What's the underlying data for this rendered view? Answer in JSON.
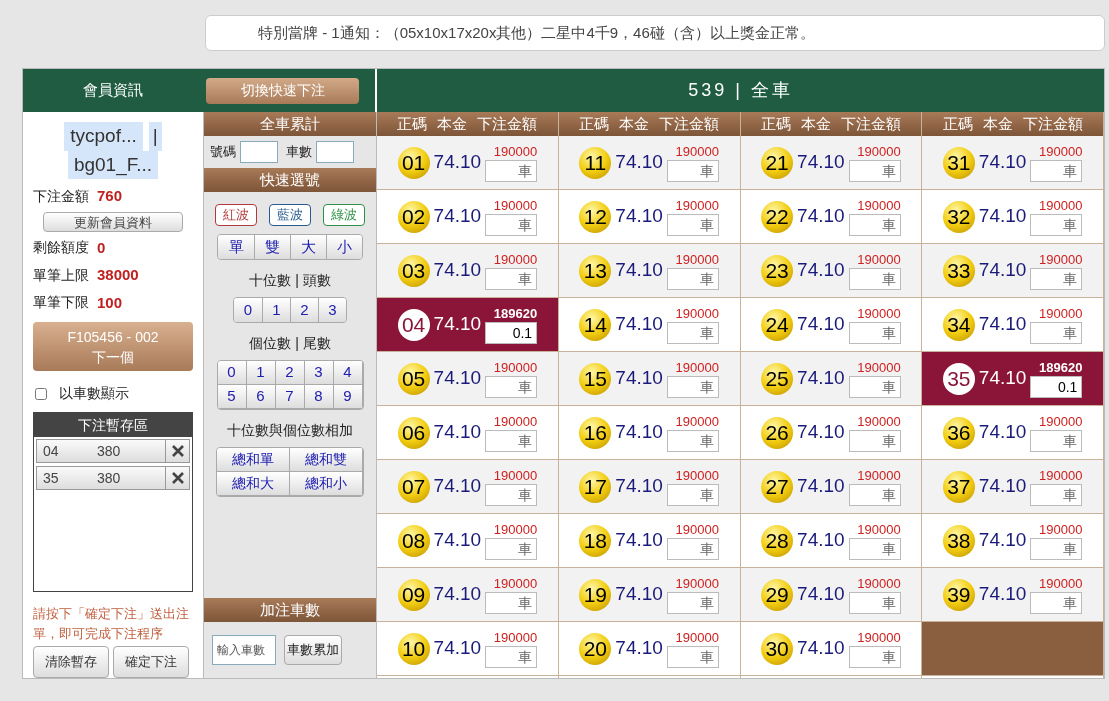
{
  "notice": "特別當牌 - 1通知：（05x10x17x20x其他）二星中4千9，46碰（含）以上獎金正常。",
  "header": {
    "member_tab": "會員資訊",
    "quick_bet_button": "切換快速下注",
    "game_title": "539 | 全車"
  },
  "member": {
    "usernames": [
      "tycpof...",
      "bg01_F..."
    ],
    "separator": "|",
    "bet_amount": {
      "label": "下注金額",
      "value": "760"
    },
    "refresh_button": "更新會員資料",
    "limits": [
      {
        "label": "剩餘額度",
        "value": "0"
      },
      {
        "label": "單筆上限",
        "value": "38000"
      },
      {
        "label": "單筆下限",
        "value": "100"
      }
    ],
    "next_button": {
      "line1": "F105456 - 002",
      "line2": "下一個"
    },
    "show_by_count": {
      "label": "以車數顯示",
      "checked": false
    },
    "staging": {
      "title": "下注暫存區",
      "items": [
        {
          "number": "04",
          "amount": "380"
        },
        {
          "number": "35",
          "amount": "380"
        }
      ]
    },
    "hint": "請按下「確定下注」送出注單，即可完成下注程序",
    "buttons": [
      "清除暫存",
      "確定下注"
    ]
  },
  "total": {
    "title": "全車累計",
    "number_label": "號碼",
    "count_label": "車數"
  },
  "quick_pick": {
    "title": "快速選號",
    "waves": [
      {
        "label": "紅波",
        "color": "#b03a3a"
      },
      {
        "label": "藍波",
        "color": "#2a5a90"
      },
      {
        "label": "綠波",
        "color": "#2f8f47"
      }
    ],
    "parity": [
      "單",
      "雙",
      "大",
      "小"
    ],
    "tens_label": "十位數 | 頭數",
    "tens": [
      "0",
      "1",
      "2",
      "3"
    ],
    "units_label": "個位數 | 尾數",
    "units": [
      "0",
      "1",
      "2",
      "3",
      "4",
      "5",
      "6",
      "7",
      "8",
      "9"
    ],
    "sum_label": "十位數與個位數相加",
    "sums": [
      "總和單",
      "總和雙",
      "總和大",
      "總和小"
    ]
  },
  "add_count": {
    "title": "加注車數",
    "placeholder": "輸入車數",
    "button": "車數累加"
  },
  "grid_headers": [
    [
      "正碼",
      "本金",
      "下注金額"
    ],
    [
      "正碼",
      "本金",
      "下注金額"
    ],
    [
      "正碼",
      "本金",
      "下注金額"
    ],
    [
      "正碼",
      "本金",
      "下注金額"
    ]
  ],
  "columns": [
    [
      {
        "kind": "number",
        "number": "01",
        "odds": "74.10",
        "limit": "190000",
        "placeholder": "車",
        "selected": false
      },
      {
        "kind": "number",
        "number": "02",
        "odds": "74.10",
        "limit": "190000",
        "placeholder": "車",
        "selected": false
      },
      {
        "kind": "number",
        "number": "03",
        "odds": "74.10",
        "limit": "190000",
        "placeholder": "車",
        "selected": false
      },
      {
        "kind": "number",
        "number": "04",
        "odds": "74.10",
        "limit": "189620",
        "value": "0.1",
        "selected": true
      },
      {
        "kind": "number",
        "number": "05",
        "odds": "74.10",
        "limit": "190000",
        "placeholder": "車",
        "selected": false
      },
      {
        "kind": "number",
        "number": "06",
        "odds": "74.10",
        "limit": "190000",
        "placeholder": "車",
        "selected": false
      },
      {
        "kind": "number",
        "number": "07",
        "odds": "74.10",
        "limit": "190000",
        "placeholder": "車",
        "selected": false
      },
      {
        "kind": "number",
        "number": "08",
        "odds": "74.10",
        "limit": "190000",
        "placeholder": "車",
        "selected": false
      },
      {
        "kind": "number",
        "number": "09",
        "odds": "74.10",
        "limit": "190000",
        "placeholder": "車",
        "selected": false
      },
      {
        "kind": "number",
        "number": "10",
        "odds": "74.10",
        "limit": "190000",
        "placeholder": "車",
        "selected": false
      }
    ],
    [
      {
        "kind": "number",
        "number": "11",
        "odds": "74.10",
        "limit": "190000",
        "placeholder": "車",
        "selected": false
      },
      {
        "kind": "number",
        "number": "12",
        "odds": "74.10",
        "limit": "190000",
        "placeholder": "車",
        "selected": false
      },
      {
        "kind": "number",
        "number": "13",
        "odds": "74.10",
        "limit": "190000",
        "placeholder": "車",
        "selected": false
      },
      {
        "kind": "number",
        "number": "14",
        "odds": "74.10",
        "limit": "190000",
        "placeholder": "車",
        "selected": false
      },
      {
        "kind": "number",
        "number": "15",
        "odds": "74.10",
        "limit": "190000",
        "placeholder": "車",
        "selected": false
      },
      {
        "kind": "number",
        "number": "16",
        "odds": "74.10",
        "limit": "190000",
        "placeholder": "車",
        "selected": false
      },
      {
        "kind": "number",
        "number": "17",
        "odds": "74.10",
        "limit": "190000",
        "placeholder": "車",
        "selected": false
      },
      {
        "kind": "number",
        "number": "18",
        "odds": "74.10",
        "limit": "190000",
        "placeholder": "車",
        "selected": false
      },
      {
        "kind": "number",
        "number": "19",
        "odds": "74.10",
        "limit": "190000",
        "placeholder": "車",
        "selected": false
      },
      {
        "kind": "number",
        "number": "20",
        "odds": "74.10",
        "limit": "190000",
        "placeholder": "車",
        "selected": false
      }
    ],
    [
      {
        "kind": "number",
        "number": "21",
        "odds": "74.10",
        "limit": "190000",
        "placeholder": "車",
        "selected": false
      },
      {
        "kind": "number",
        "number": "22",
        "odds": "74.10",
        "limit": "190000",
        "placeholder": "車",
        "selected": false
      },
      {
        "kind": "number",
        "number": "23",
        "odds": "74.10",
        "limit": "190000",
        "placeholder": "車",
        "selected": false
      },
      {
        "kind": "number",
        "number": "24",
        "odds": "74.10",
        "limit": "190000",
        "placeholder": "車",
        "selected": false
      },
      {
        "kind": "number",
        "number": "25",
        "odds": "74.10",
        "limit": "190000",
        "placeholder": "車",
        "selected": false
      },
      {
        "kind": "number",
        "number": "26",
        "odds": "74.10",
        "limit": "190000",
        "placeholder": "車",
        "selected": false
      },
      {
        "kind": "number",
        "number": "27",
        "odds": "74.10",
        "limit": "190000",
        "placeholder": "車",
        "selected": false
      },
      {
        "kind": "number",
        "number": "28",
        "odds": "74.10",
        "limit": "190000",
        "placeholder": "車",
        "selected": false
      },
      {
        "kind": "number",
        "number": "29",
        "odds": "74.10",
        "limit": "190000",
        "placeholder": "車",
        "selected": false
      },
      {
        "kind": "number",
        "number": "30",
        "odds": "74.10",
        "limit": "190000",
        "placeholder": "車",
        "selected": false
      }
    ],
    [
      {
        "kind": "number",
        "number": "31",
        "odds": "74.10",
        "limit": "190000",
        "placeholder": "車",
        "selected": false
      },
      {
        "kind": "number",
        "number": "32",
        "odds": "74.10",
        "limit": "190000",
        "placeholder": "車",
        "selected": false
      },
      {
        "kind": "number",
        "number": "33",
        "odds": "74.10",
        "limit": "190000",
        "placeholder": "車",
        "selected": false
      },
      {
        "kind": "number",
        "number": "34",
        "odds": "74.10",
        "limit": "190000",
        "placeholder": "車",
        "selected": false
      },
      {
        "kind": "number",
        "number": "35",
        "odds": "74.10",
        "limit": "189620",
        "value": "0.1",
        "selected": true
      },
      {
        "kind": "number",
        "number": "36",
        "odds": "74.10",
        "limit": "190000",
        "placeholder": "車",
        "selected": false
      },
      {
        "kind": "number",
        "number": "37",
        "odds": "74.10",
        "limit": "190000",
        "placeholder": "車",
        "selected": false
      },
      {
        "kind": "number",
        "number": "38",
        "odds": "74.10",
        "limit": "190000",
        "placeholder": "車",
        "selected": false
      },
      {
        "kind": "number",
        "number": "39",
        "odds": "74.10",
        "limit": "190000",
        "placeholder": "車",
        "selected": false
      },
      {
        "kind": "blank"
      }
    ]
  ]
}
